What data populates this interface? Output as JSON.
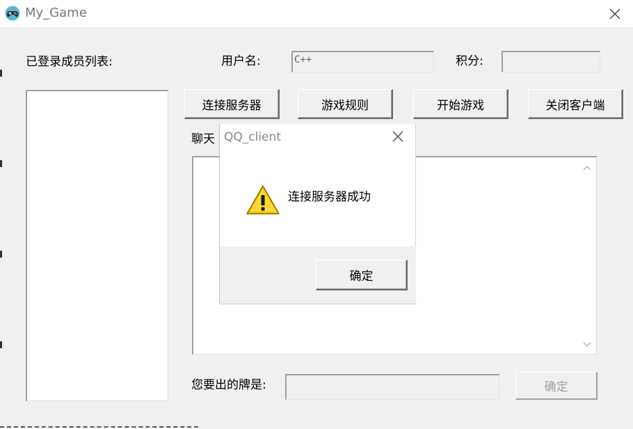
{
  "window": {
    "title": "My_Game",
    "icon": "gamepad-icon",
    "close_icon": "close-icon"
  },
  "labels": {
    "members": "已登录成员列表:",
    "username": "用户名:",
    "score": "积分:",
    "chat_partial": "聊天",
    "card_prompt": "您要出的牌是:"
  },
  "fields": {
    "username_value": "C++",
    "score_value": "",
    "card_value": ""
  },
  "buttons": {
    "connect": "连接服务器",
    "rules": "游戏规则",
    "start": "开始游戏",
    "close_client": "关闭客户端",
    "confirm": "确定"
  },
  "dialog": {
    "title": "QQ_client",
    "message": "连接服务器成功",
    "ok": "确定",
    "icon": "warning-icon",
    "close_icon": "close-icon"
  },
  "colors": {
    "warning_fill": "#f2c200",
    "window_bg": "#f0f0f0"
  }
}
